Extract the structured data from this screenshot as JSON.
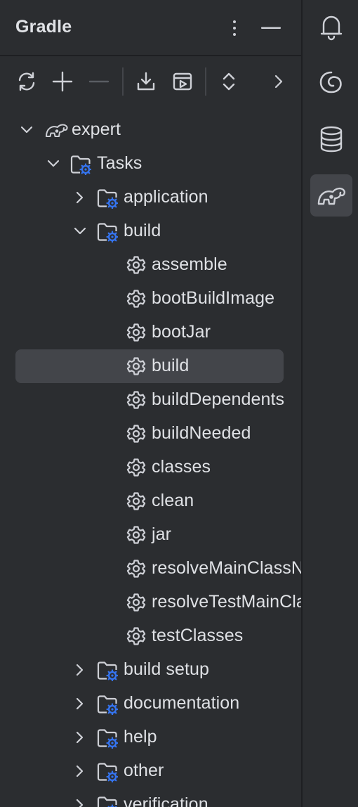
{
  "header": {
    "title": "Gradle"
  },
  "icons": {
    "more": "more-vertical-icon",
    "minimize": "minimize-icon",
    "reload": "reload-icon",
    "add": "add-icon",
    "remove": "remove-icon",
    "download": "download-sources-icon",
    "run": "run-task-icon",
    "expand": "expand-collapse-icon",
    "next": "chevron-right-icon"
  },
  "tree": {
    "root": "expert",
    "tasks": "Tasks",
    "groups": {
      "application": "application",
      "build": "build",
      "build_setup": "build setup",
      "documentation": "documentation",
      "help": "help",
      "other": "other",
      "verification": "verification"
    },
    "build_tasks": [
      "assemble",
      "bootBuildImage",
      "bootJar",
      "build",
      "buildDependents",
      "buildNeeded",
      "classes",
      "clean",
      "jar",
      "resolveMainClassName",
      "resolveTestMainClassName",
      "testClasses"
    ],
    "selected": "build"
  },
  "sidebar": [
    "notifications-icon",
    "ai-assistant-icon",
    "database-icon",
    "gradle-icon"
  ],
  "colors": {
    "background": "#2b2d30",
    "selected": "#43454a",
    "text": "#dfe1e5",
    "accent": "#3574f0",
    "icon": "#ced0d6"
  }
}
